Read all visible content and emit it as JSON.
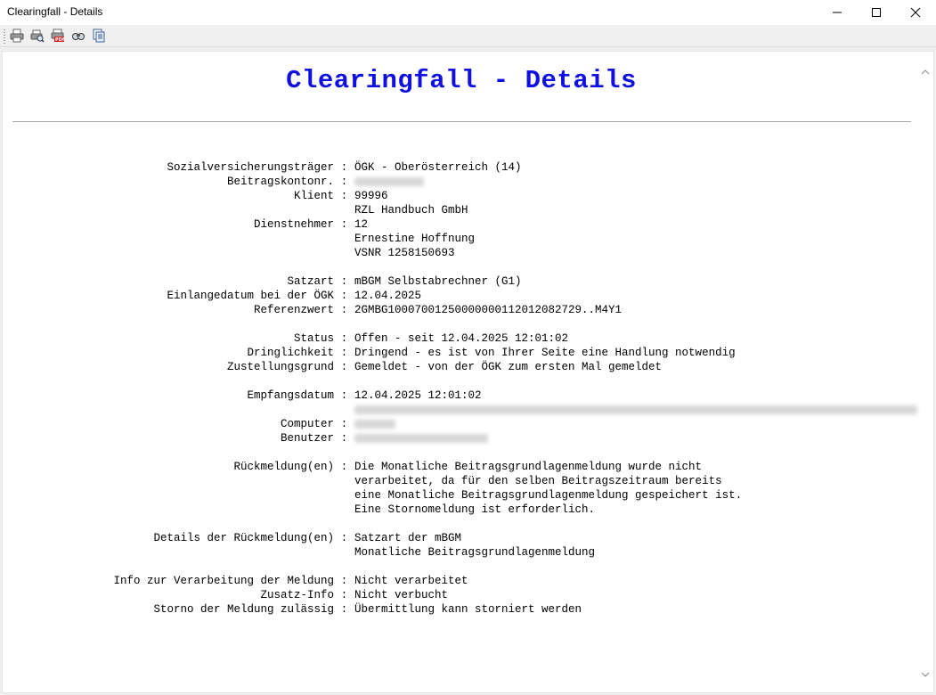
{
  "window": {
    "title": "Clearingfall - Details",
    "controls": [
      "minimize-icon",
      "maximize-icon",
      "close-icon"
    ]
  },
  "toolbar": {
    "icons": [
      "print-icon",
      "print-preview-icon",
      "pdf-icon",
      "find-icon",
      "copy-icon"
    ]
  },
  "document": {
    "title": "Clearingfall - Details",
    "fields": {
      "sv_traeger": {
        "label": "Sozialversicherungsträger",
        "value": "ÖGK - Oberösterreich (14)"
      },
      "beitragskontonr": {
        "label": "Beitragskontonr.",
        "value": ""
      },
      "klient": {
        "label": "Klient",
        "lines": [
          "99996",
          "RZL Handbuch GmbH"
        ]
      },
      "dienstnehmer": {
        "label": "Dienstnehmer",
        "lines": [
          "12",
          "Ernestine Hoffnung",
          "VSNR 1258150693"
        ]
      },
      "satzart": {
        "label": "Satzart",
        "value": "mBGM Selbstabrechner (G1)"
      },
      "einlangedatum": {
        "label": "Einlangedatum bei der ÖGK",
        "value": "12.04.2025"
      },
      "referenzwert": {
        "label": "Referenzwert",
        "value": "2GMBG1000700125000000011201208272​9..M4Y1"
      },
      "status": {
        "label": "Status",
        "value": "Offen - seit 12.04.2025 12:01:02"
      },
      "dringlichkeit": {
        "label": "Dringlichkeit",
        "value": "Dringend - es ist von Ihrer Seite eine Handlung notwendig"
      },
      "zustellungsgrund": {
        "label": "Zustellungsgrund",
        "value": "Gemeldet - von der ÖGK zum ersten Mal gemeldet"
      },
      "empfangsdatum": {
        "label": "Empfangsdatum",
        "value": "12.04.2025 12:01:02"
      },
      "computer": {
        "label": "Computer",
        "value": ""
      },
      "benutzer": {
        "label": "Benutzer",
        "value": ""
      },
      "rueckmeldung": {
        "label": "Rückmeldung(en)",
        "lines": [
          "Die Monatliche Beitragsgrundlagenmeldung wurde nicht",
          "verarbeitet, da für den selben Beitragszeitraum bereits",
          "eine Monatliche Beitragsgrundlagenmeldung gespeichert ist.",
          "Eine Stornomeldung ist erforderlich."
        ]
      },
      "details_rueckmeldung": {
        "label": "Details der Rückmeldung(en)",
        "lines": [
          "Satzart der mBGM",
          "Monatliche Beitragsgrundlagenmeldung"
        ]
      },
      "info_verarbeitung": {
        "label": "Info zur Verarbeitung der Meldung",
        "value": "Nicht verarbeitet"
      },
      "zusatz_info": {
        "label": "Zusatz-Info",
        "value": "Nicht verbucht"
      },
      "storno_zulaessig": {
        "label": "Storno der Meldung zulässig",
        "value": "Übermittlung kann storniert werden"
      }
    },
    "separator": ":"
  },
  "colors": {
    "title": "#1010e0",
    "background": "#ffffff",
    "chrome": "#f0f0f0"
  }
}
